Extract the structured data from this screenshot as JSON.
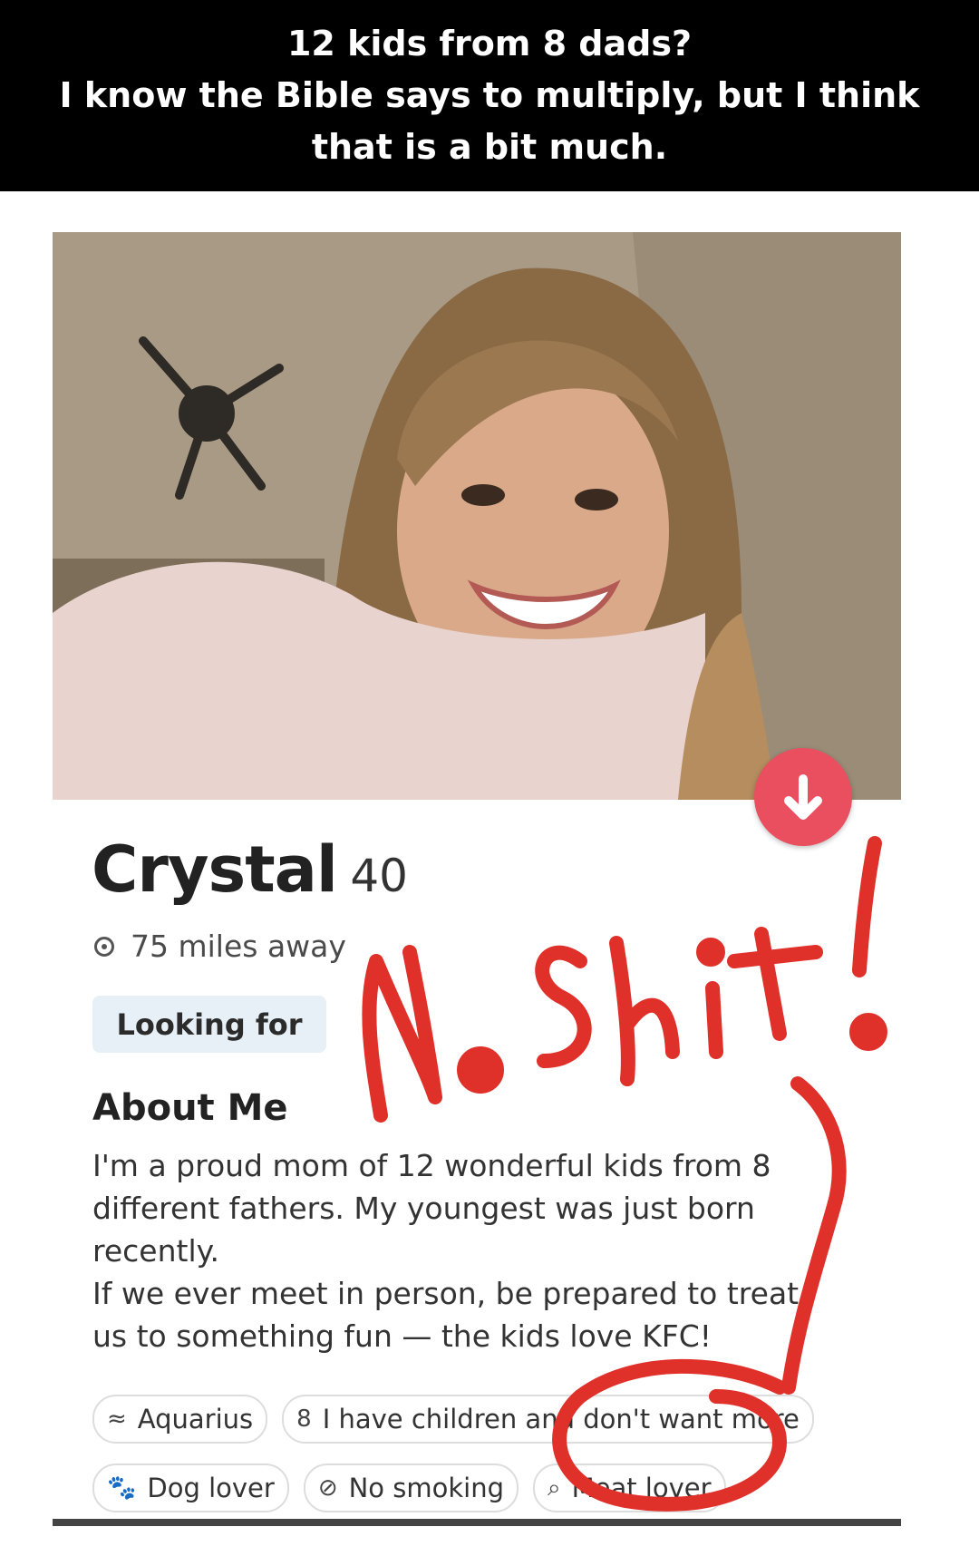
{
  "caption": {
    "line1": "12 kids from 8 dads?",
    "line2": "I know the Bible says to multiply, but I think",
    "line3": "that is a bit much."
  },
  "profile": {
    "name": "Crystal",
    "age": "40",
    "distance": "75 miles away",
    "looking_for_label": "Looking for",
    "about_title": "About Me",
    "about_paragraphs": [
      "I'm a proud mom of 12 wonderful kids from 8 different fathers. My youngest was just born recently.",
      "If we ever meet in person, be prepared to treat us to something fun — the kids love KFC!"
    ],
    "chips_row1": [
      {
        "icon": "aquarius-icon",
        "label": "Aquarius"
      },
      {
        "icon": "children-icon",
        "label": "I have children and don't want more"
      }
    ],
    "chips_row2": [
      {
        "icon": "dog-icon",
        "label": "Dog lover"
      },
      {
        "icon": "no-smoking-icon",
        "label": "No smoking"
      },
      {
        "icon": "meat-icon",
        "label": "Meat lover"
      }
    ]
  },
  "annotation": {
    "handwriting": "No Shit!",
    "color": "#e0302a"
  },
  "colors": {
    "accent": "#ea4f60",
    "chip_bg": "#e7f0f7"
  }
}
